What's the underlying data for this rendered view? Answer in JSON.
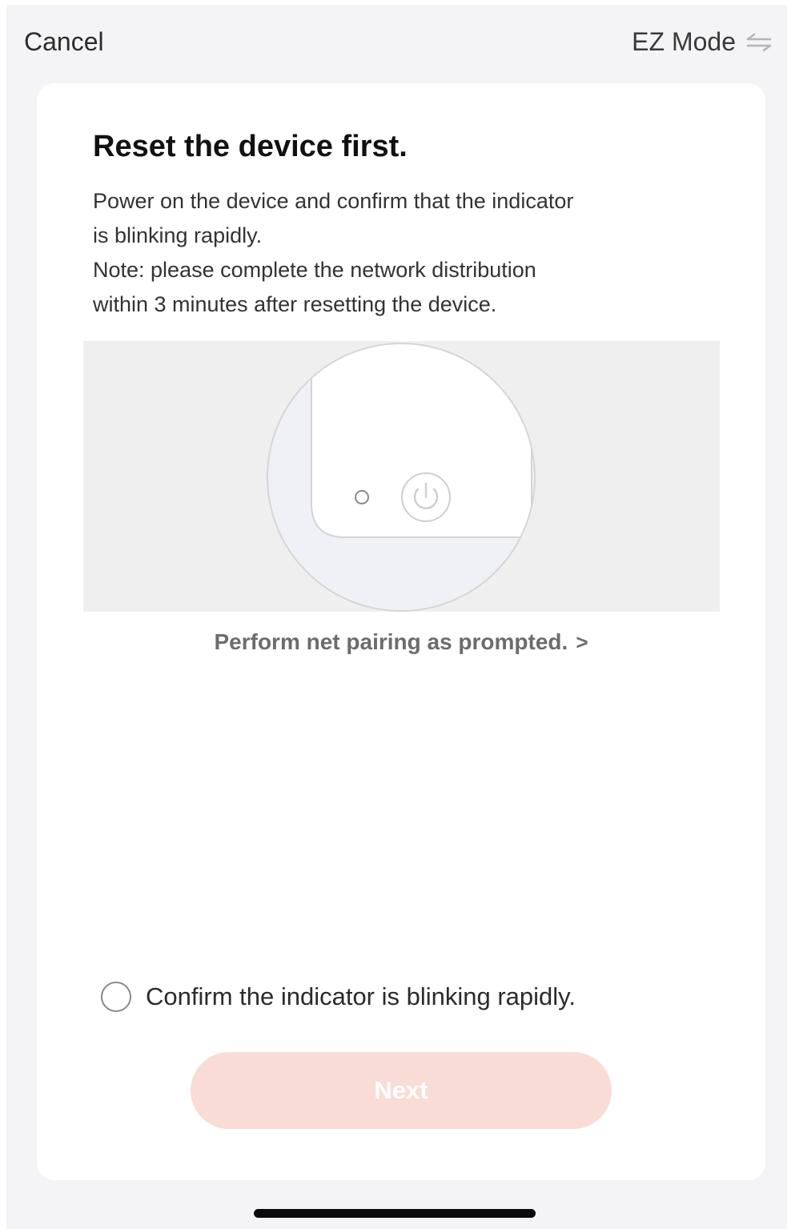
{
  "header": {
    "cancel_label": "Cancel",
    "mode_label": "EZ Mode",
    "mode_icon": "swap-arrows-icon"
  },
  "content": {
    "title": "Reset the device first.",
    "description_lines": [
      "Power on the device and confirm that the indicator",
      "is blinking rapidly.",
      "Note: please complete the network distribution",
      "within 3 minutes after resetting the device."
    ],
    "illustration_icons": [
      "indicator-light-icon",
      "power-icon"
    ],
    "help_link": "Perform net pairing as prompted.",
    "help_chevron": ">"
  },
  "confirm": {
    "label": "Confirm the indicator is blinking rapidly.",
    "checked": false
  },
  "actions": {
    "next_label": "Next",
    "next_enabled": false
  },
  "colors": {
    "next_button_bg": "#f9dcd6",
    "screen_bg": "#f4f4f6",
    "card_bg": "#ffffff"
  }
}
